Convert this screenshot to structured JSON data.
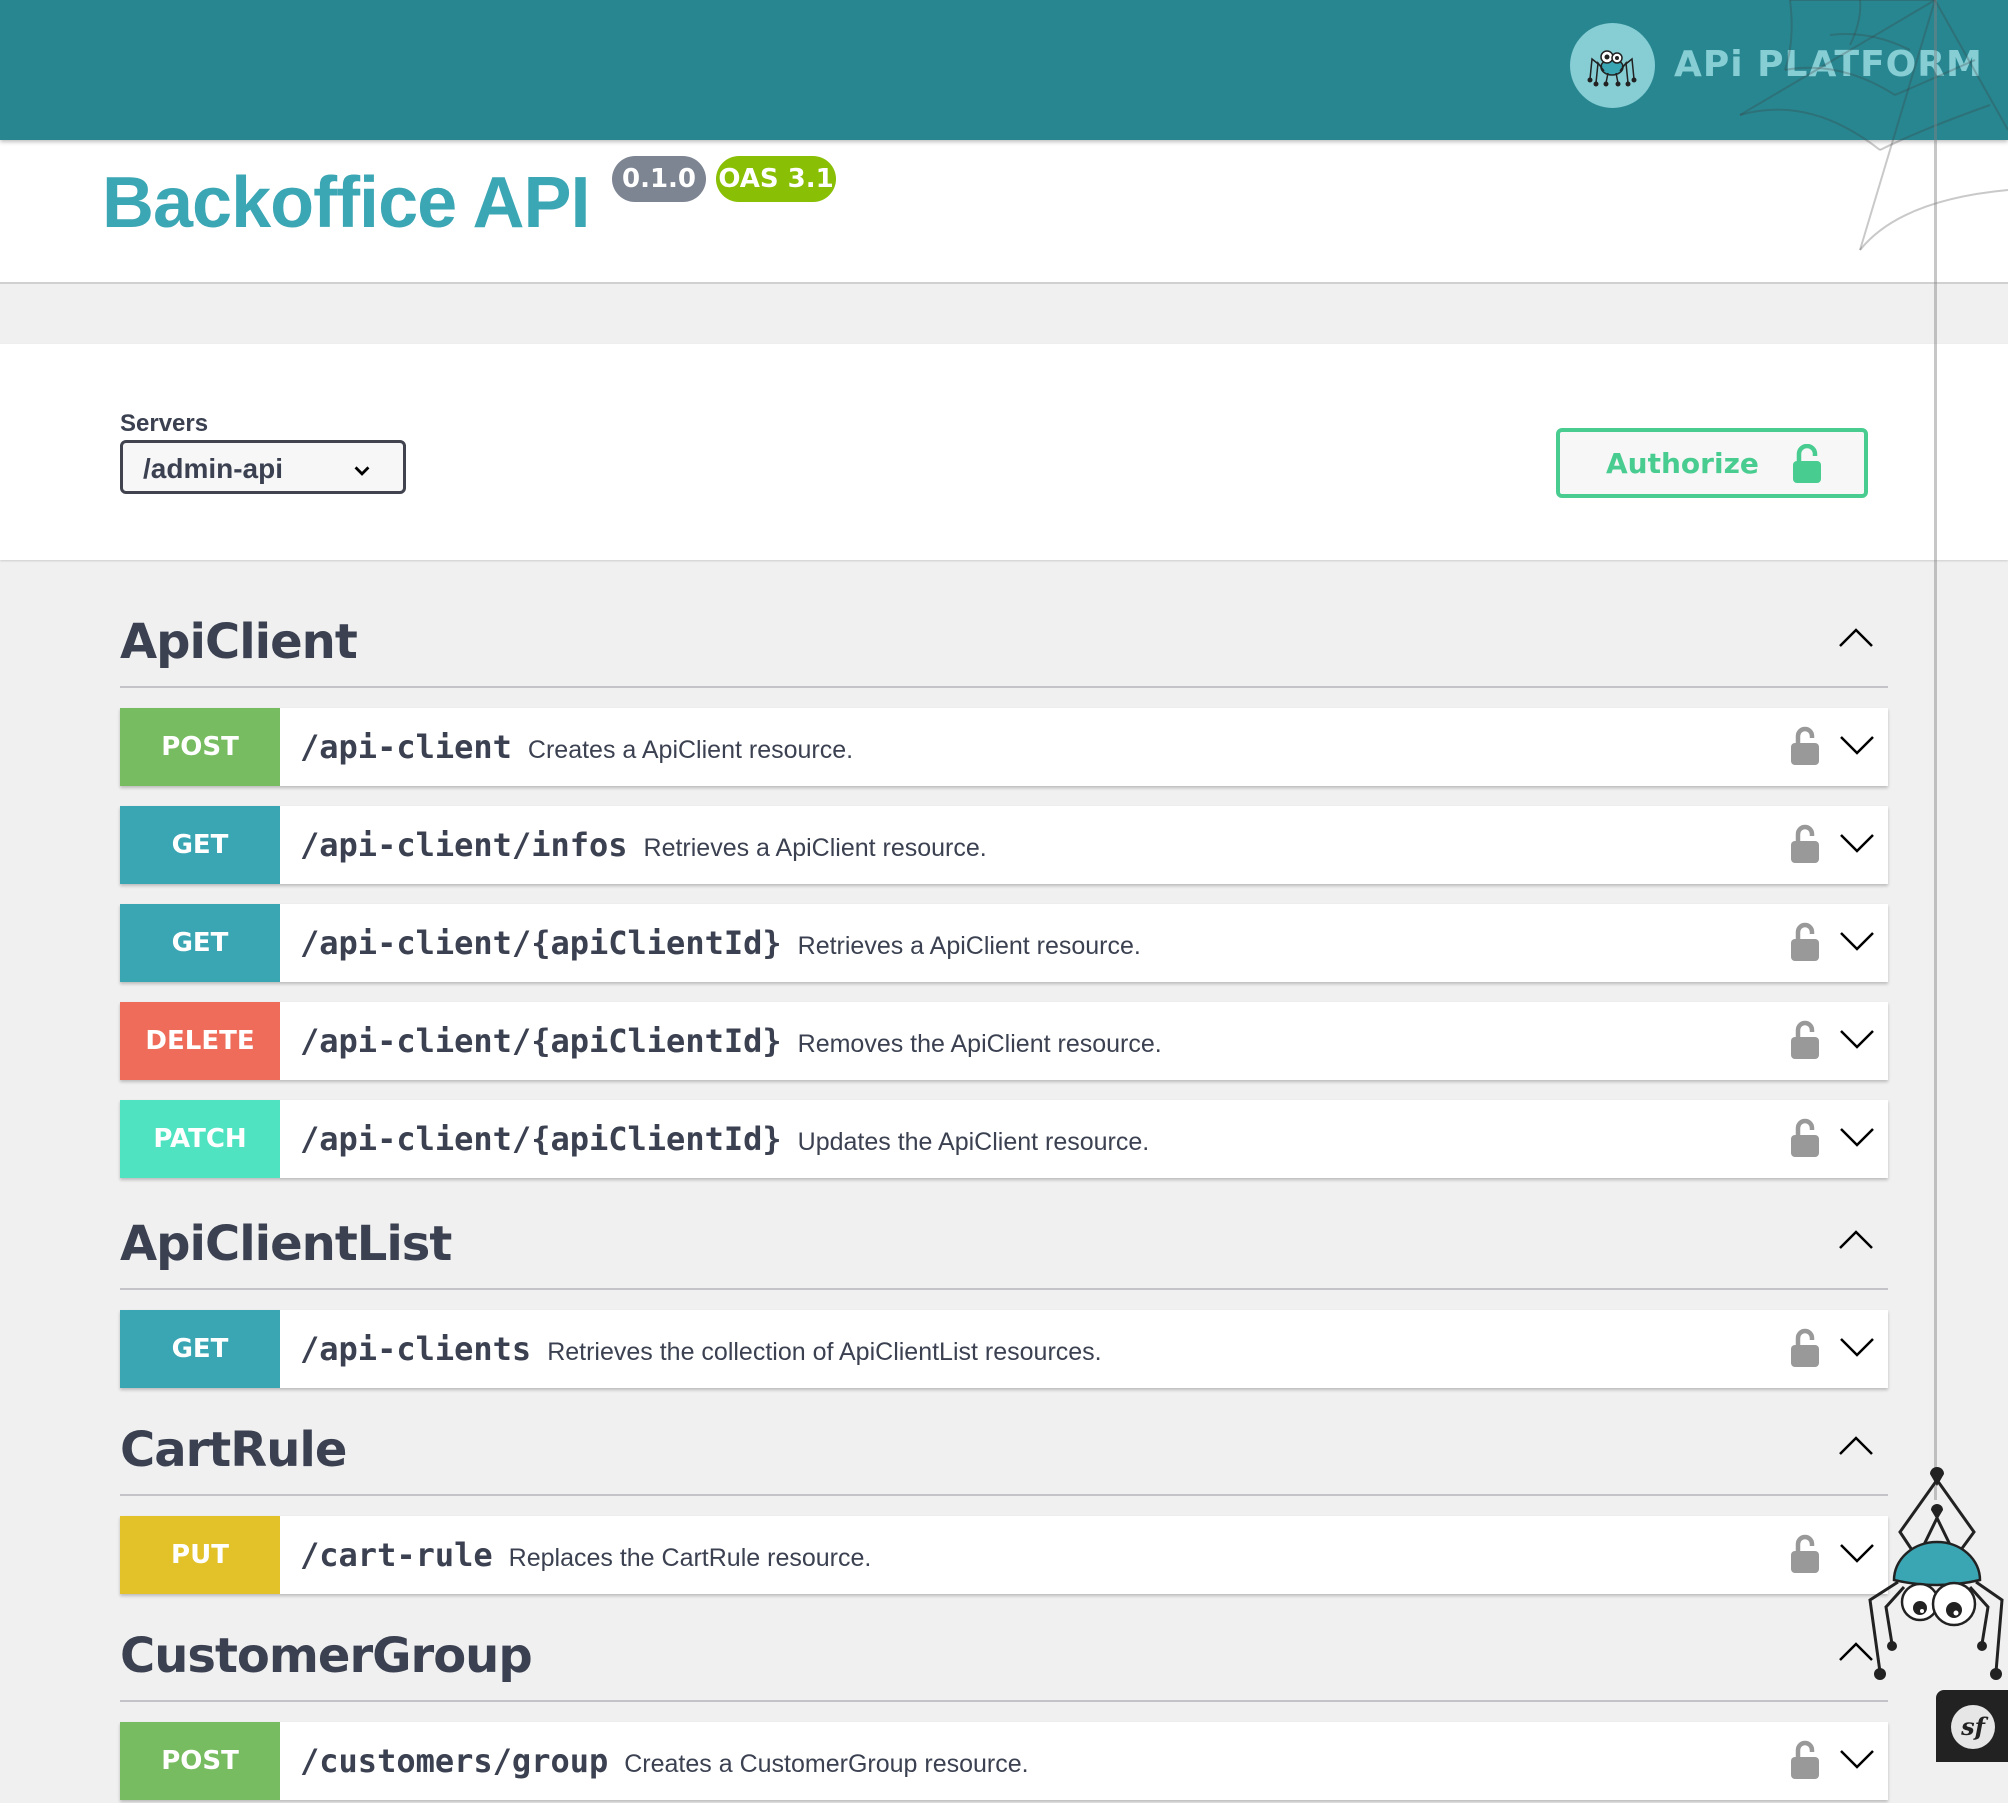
{
  "header": {
    "logo_text": "APi PLATFORM",
    "logo_icon": "spider-logo-icon"
  },
  "info": {
    "title": "Backoffice API",
    "version": "0.1.0",
    "oas_version": "OAS 3.1"
  },
  "servers": {
    "label": "Servers",
    "selected": "/admin-api"
  },
  "authorize": {
    "label": "Authorize",
    "icon": "unlock-icon"
  },
  "colors": {
    "header": "#288690",
    "title": "#3ba6b4",
    "post": "#78bc61",
    "get": "#3aa6b4",
    "delete": "#ef6c5b",
    "patch": "#50e3c2",
    "put": "#e3c229",
    "authorize": "#49cc90"
  },
  "sections": [
    {
      "name": "ApiClient",
      "expanded": true,
      "operations": [
        {
          "method": "POST",
          "path": "/api-client",
          "summary": "Creates a ApiClient resource."
        },
        {
          "method": "GET",
          "path": "/api-client/infos",
          "summary": "Retrieves a ApiClient resource."
        },
        {
          "method": "GET",
          "path": "/api-client/{apiClientId}",
          "summary": "Retrieves a ApiClient resource."
        },
        {
          "method": "DELETE",
          "path": "/api-client/{apiClientId}",
          "summary": "Removes the ApiClient resource."
        },
        {
          "method": "PATCH",
          "path": "/api-client/{apiClientId}",
          "summary": "Updates the ApiClient resource."
        }
      ]
    },
    {
      "name": "ApiClientList",
      "expanded": true,
      "operations": [
        {
          "method": "GET",
          "path": "/api-clients",
          "summary": "Retrieves the collection of ApiClientList resources."
        }
      ]
    },
    {
      "name": "CartRule",
      "expanded": true,
      "operations": [
        {
          "method": "PUT",
          "path": "/cart-rule",
          "summary": "Replaces the CartRule resource."
        }
      ]
    },
    {
      "name": "CustomerGroup",
      "expanded": true,
      "operations": [
        {
          "method": "POST",
          "path": "/customers/group",
          "summary": "Creates a CustomerGroup resource."
        }
      ]
    }
  ],
  "symfony_toolbar": {
    "logo": "sf"
  }
}
